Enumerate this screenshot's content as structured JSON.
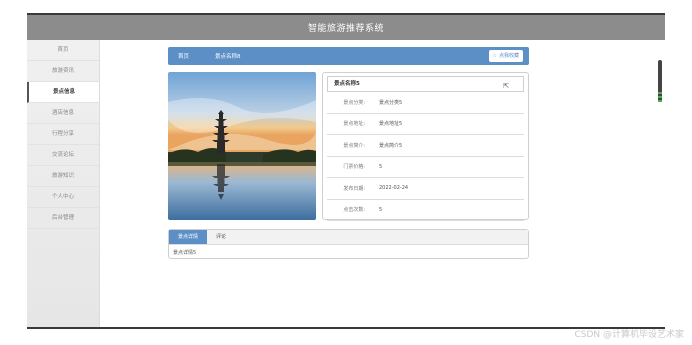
{
  "app": {
    "title": "智能旅游推荐系统"
  },
  "sidebar": {
    "items": [
      {
        "label": "首页"
      },
      {
        "label": "旅游资讯"
      },
      {
        "label": "景点信息",
        "active": true
      },
      {
        "label": "酒店信息"
      },
      {
        "label": "行程分享"
      },
      {
        "label": "交流论坛"
      },
      {
        "label": "旅游知识"
      },
      {
        "label": "个人中心"
      },
      {
        "label": "后台管理"
      }
    ]
  },
  "breadcrumb": {
    "home": "首页",
    "current": "景点名称8"
  },
  "favorite": {
    "icon": "star-outline-icon",
    "label": "点我收藏"
  },
  "detail": {
    "title": "景点名称5",
    "rows": [
      {
        "label": "景点分类:",
        "value": "景点分类5"
      },
      {
        "label": "景点地址:",
        "value": "景点地址5"
      },
      {
        "label": "景点简介:",
        "value": "景点简介5"
      },
      {
        "label": "门票价格:",
        "value": "5"
      },
      {
        "label": "发布日期:",
        "value": "2022-02-24"
      },
      {
        "label": "点击次数:",
        "value": "5"
      }
    ]
  },
  "tabs": [
    {
      "label": "景点详情",
      "active": true
    },
    {
      "label": "评论"
    }
  ],
  "tab_content": "景点详情5",
  "watermark": "CSDN @计算机毕设艺术家",
  "colors": {
    "accent": "#5d8fc7",
    "header": "#8c8c8c"
  }
}
